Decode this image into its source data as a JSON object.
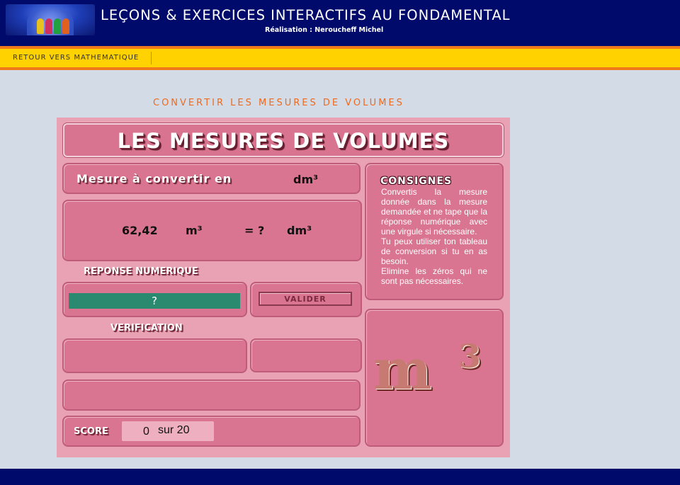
{
  "header": {
    "title": "LEÇONS & EXERCICES INTERACTIFS AU FONDAMENTAL",
    "subtitle": "Réalisation : Neroucheff Michel"
  },
  "nav": {
    "back_link": "RETOUR VERS MATHEMATIQUE"
  },
  "page": {
    "heading": "CONVERTIR LES MESURES DE VOLUMES"
  },
  "exercise": {
    "banner": "LES MESURES DE VOLUMES",
    "convert_label": "Mesure à convertir en",
    "target_unit": "dm³",
    "given_value": "62,42",
    "given_unit": "m³",
    "equals": "= ?",
    "answer_unit": "dm³",
    "response_label": "REPONSE NUMERIQUE",
    "answer_value": "?",
    "validate_label": "VALIDER",
    "verification_label": "VERIFICATION",
    "score_label": "SCORE",
    "score_value": "0",
    "score_total": "sur 20",
    "unit_graphic_base": "m",
    "unit_graphic_exp": "3"
  },
  "instructions": {
    "title": "CONSIGNES",
    "paragraphs": [
      "Convertis la mesure donnée dans la mesure demandée et ne tape que la réponse numérique avec une virgule si nécessaire.",
      "Tu peux utiliser ton tableau de conversion si tu en as besoin.",
      "Elimine les zéros qui ne sont pas nécessaires."
    ]
  },
  "colors": {
    "header_bg": "#000a6b",
    "nav_bg": "#ffd200",
    "accent_orange": "#f07a1a",
    "panel_pink": "#e9a2b4",
    "box_pink": "#d97590",
    "input_teal": "#2a8a70"
  }
}
